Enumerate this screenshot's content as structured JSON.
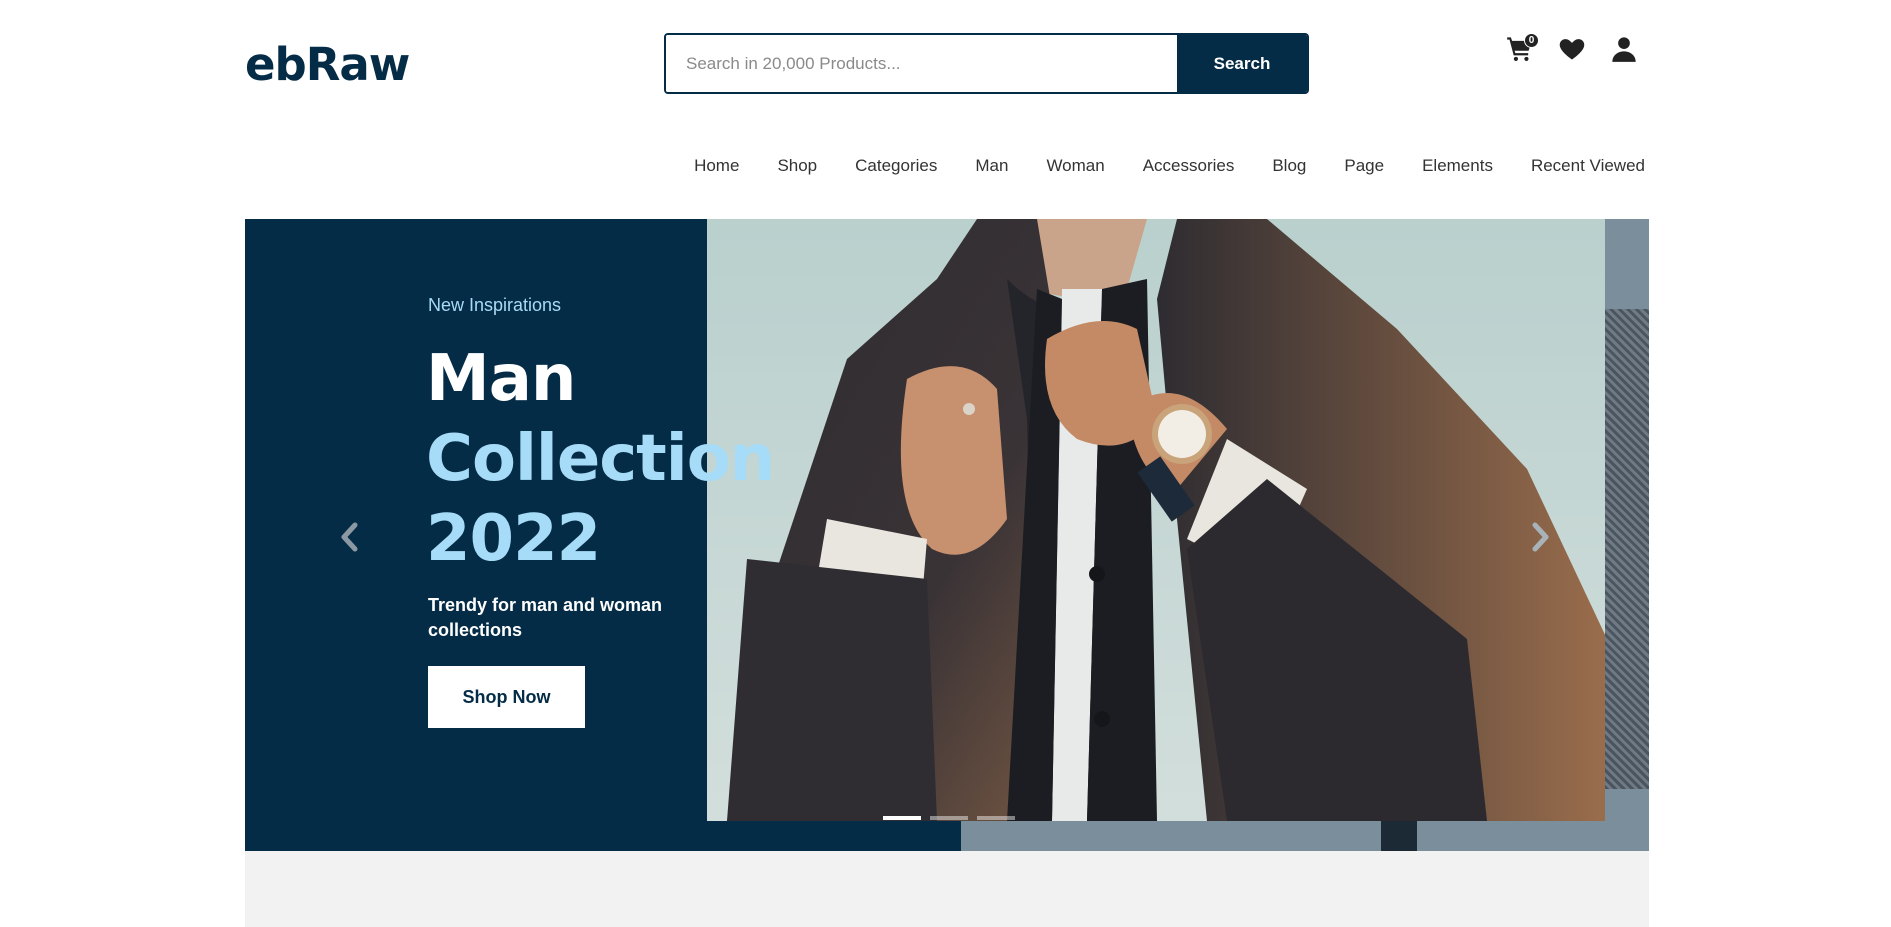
{
  "header": {
    "logo_text": "ebRaw",
    "search": {
      "placeholder": "Search in 20,000 Products...",
      "value": "",
      "button_label": "Search"
    },
    "cart_count": "0",
    "icons": [
      "cart-icon",
      "heart-icon",
      "user-icon"
    ]
  },
  "nav": {
    "items": [
      {
        "label": "Home"
      },
      {
        "label": "Shop"
      },
      {
        "label": "Categories"
      },
      {
        "label": "Man"
      },
      {
        "label": "Woman"
      },
      {
        "label": "Accessories"
      },
      {
        "label": "Blog"
      },
      {
        "label": "Page"
      },
      {
        "label": "Elements"
      },
      {
        "label": "Recent Viewed"
      }
    ]
  },
  "hero": {
    "subtitle": "New Inspirations",
    "title_line1": "Man",
    "title_line2": "Collection",
    "title_line3": "2022",
    "description": "Trendy for man and woman collections",
    "cta_label": "Shop Now",
    "slides_total": 3,
    "active_slide": 1
  },
  "colors": {
    "brand_navy": "#052c47",
    "accent_light_blue": "#a6dcf8",
    "white": "#ffffff"
  }
}
